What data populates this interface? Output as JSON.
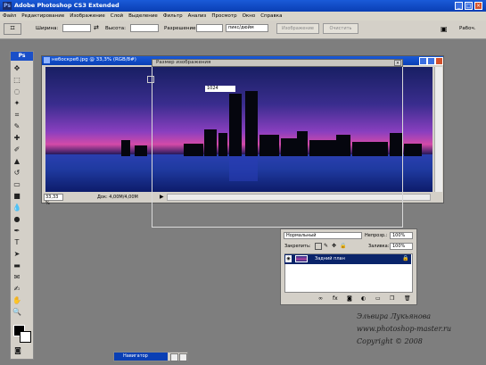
{
  "titlebar": {
    "title": "Adobe Photoshop CS3 Extended"
  },
  "menu": [
    "Файл",
    "Редактирование",
    "Изображение",
    "Слой",
    "Выделение",
    "Фильтр",
    "Анализ",
    "Просмотр",
    "Окно",
    "Справка"
  ],
  "options": {
    "width_label": "Ширина:",
    "height_label": "Высота:",
    "resolution_label": "Разрешение:",
    "units_value": "пикс/дюйм",
    "front_image_button": "Изображение",
    "clear_button": "Очистить",
    "workspace_label": "Рабоч."
  },
  "document": {
    "title": "небоскреб.jpg @ 33,3% (RGB/8#)",
    "zoom": "33,33 %",
    "doc_info": "Док: 4,00М/4,00М"
  },
  "dialog": {
    "title": "Размер изображения"
  },
  "tooltip": {
    "text": "1024"
  },
  "layers": {
    "blend_mode": "Нормальный",
    "opacity_label": "Непрозр.:",
    "opacity_value": "100%",
    "lock_label": "Закрепить:",
    "fill_label": "Заливка:",
    "fill_value": "100%",
    "layer_name": "Задний план"
  },
  "taskbar": {
    "title": "Навигатор"
  },
  "watermark": {
    "name": "Эльвира Лукьянова",
    "site": "www.photoshop-master.ru",
    "copyright": "Copyright © 2008"
  },
  "colors": {
    "titlebar": "#0a3fb4",
    "panel": "#d4d0c8",
    "workspace": "#7e7e7e",
    "selection": "#0a246a"
  }
}
